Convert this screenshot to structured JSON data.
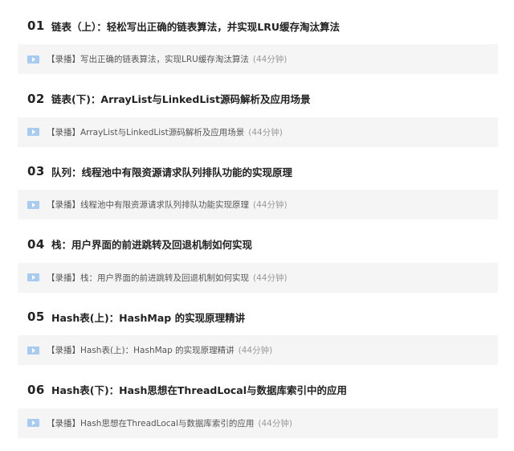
{
  "chapters": [
    {
      "number": "01",
      "title": "链表（上）：轻松写出正确的链表算法，并实现LRU缓存淘汰算法",
      "lesson": {
        "title": "【录播】写出正确的链表算法，实现LRU缓存淘汰算法",
        "duration": "(44分钟)",
        "icon": "video-play-icon"
      }
    },
    {
      "number": "02",
      "title": "链表(下)：ArrayList与LinkedList源码解析及应用场景",
      "lesson": {
        "title": "【录播】ArrayList与LinkedList源码解析及应用场景",
        "duration": "(44分钟)",
        "icon": "video-play-icon"
      }
    },
    {
      "number": "03",
      "title": "队列：线程池中有限资源请求队列排队功能的实现原理",
      "lesson": {
        "title": "【录播】线程池中有限资源请求队列排队功能实现原理",
        "duration": "(44分钟)",
        "icon": "video-play-icon"
      }
    },
    {
      "number": "04",
      "title": "栈：用户界面的前进跳转及回退机制如何实现",
      "lesson": {
        "title": "【录播】栈：用户界面的前进跳转及回退机制如何实现",
        "duration": "(44分钟)",
        "icon": "video-play-icon"
      }
    },
    {
      "number": "05",
      "title": "Hash表(上)：HashMap 的实现原理精讲",
      "lesson": {
        "title": "【录播】Hash表(上)：HashMap 的实现原理精讲",
        "duration": "(44分钟)",
        "icon": "video-play-icon"
      }
    },
    {
      "number": "06",
      "title": "Hash表(下)：Hash思想在ThreadLocal与数据库索引中的应用",
      "lesson": {
        "title": "【录播】Hash思想在ThreadLocal与数据库索引的应用",
        "duration": "(44分钟)",
        "icon": "video-play-icon"
      }
    }
  ],
  "colors": {
    "lesson_background": "#f5f5f5",
    "play_icon": "#a9cbef",
    "duration_text": "#999999",
    "heading_text": "#222222"
  }
}
